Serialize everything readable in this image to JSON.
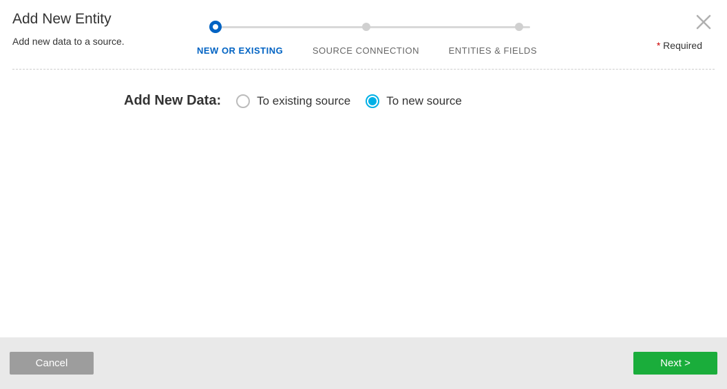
{
  "header": {
    "title": "Add New Entity",
    "subtitle": "Add new data to a source.",
    "required_label": "Required"
  },
  "stepper": {
    "steps": [
      {
        "label": "NEW OR EXISTING"
      },
      {
        "label": "SOURCE CONNECTION"
      },
      {
        "label": "ENTITIES & FIELDS"
      }
    ]
  },
  "form": {
    "section_label": "Add New Data:",
    "options": [
      {
        "label": "To existing source"
      },
      {
        "label": "To new source"
      }
    ]
  },
  "footer": {
    "cancel_label": "Cancel",
    "next_label": "Next >"
  }
}
